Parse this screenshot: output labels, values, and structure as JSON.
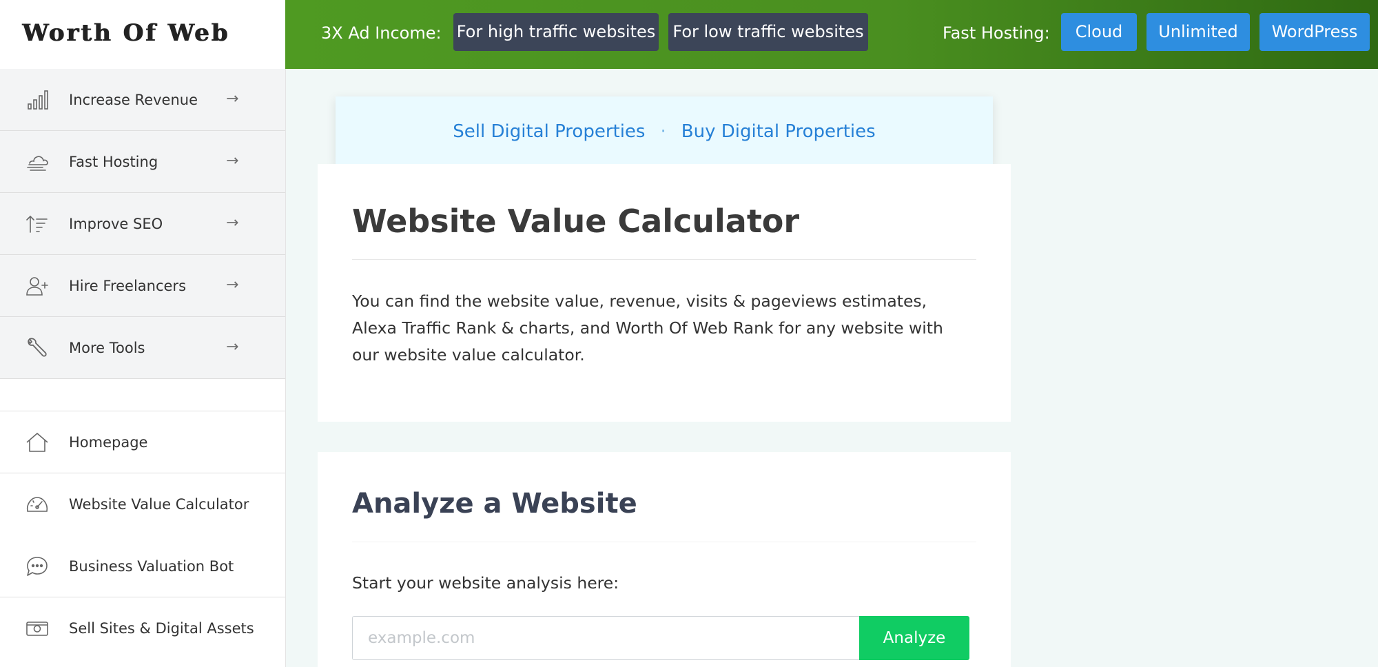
{
  "brand": {
    "logo_text": "Worth Of Web"
  },
  "topbar": {
    "ad_label": "3X Ad Income:",
    "ad_buttons": [
      "For high traffic websites",
      "For low traffic websites"
    ],
    "hosting_label": "Fast Hosting:",
    "hosting_buttons": [
      "Cloud",
      "Unlimited",
      "WordPress"
    ]
  },
  "sidebar": {
    "primary_items": [
      {
        "label": "Increase Revenue",
        "icon": "bar-chart-icon",
        "arrow": "→"
      },
      {
        "label": "Fast Hosting",
        "icon": "cloud-icon",
        "arrow": "→"
      },
      {
        "label": "Improve SEO",
        "icon": "sort-ascending-icon",
        "arrow": "→"
      },
      {
        "label": "Hire Freelancers",
        "icon": "user-plus-icon",
        "arrow": "→"
      },
      {
        "label": "More Tools",
        "icon": "wrench-icon",
        "arrow": "→"
      }
    ],
    "secondary_items": [
      {
        "label": "Homepage",
        "icon": "home-icon"
      },
      {
        "label": "Website Value Calculator",
        "icon": "speedometer-icon"
      },
      {
        "label": "Business Valuation Bot",
        "icon": "chat-bubble-icon"
      },
      {
        "label": "Sell Sites & Digital Assets",
        "icon": "money-icon"
      }
    ]
  },
  "promo": {
    "sell_link": "Sell Digital Properties",
    "separator": "·",
    "buy_link": "Buy Digital Properties"
  },
  "calculator": {
    "title": "Website Value Calculator",
    "description": "You can find the website value, revenue, visits & pageviews estimates, Alexa Traffic Rank & charts, and Worth Of Web Rank for any website with our website value calculator."
  },
  "analyze": {
    "title": "Analyze a Website",
    "start_label": "Start your website analysis here:",
    "input_placeholder": "example.com",
    "input_value": "",
    "button_label": "Analyze"
  },
  "colors": {
    "topbar_green": "#4f9a22",
    "dark_button": "#3c4558",
    "blue_button": "#2e8ee0",
    "link_blue": "#2680d6",
    "analyze_green": "#10cc63"
  }
}
